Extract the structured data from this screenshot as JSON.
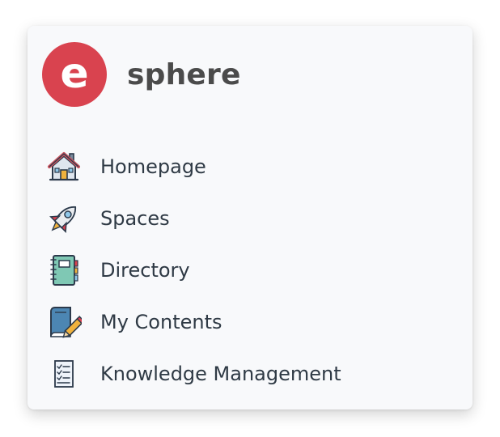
{
  "brand": {
    "logo_letter": "e",
    "name": "sphere",
    "logo_color": "#d9434f"
  },
  "menu": {
    "items": [
      {
        "label": "Homepage",
        "icon": "house-icon"
      },
      {
        "label": "Spaces",
        "icon": "rocket-icon"
      },
      {
        "label": "Directory",
        "icon": "notebook-icon"
      },
      {
        "label": "My Contents",
        "icon": "book-pencil-icon"
      },
      {
        "label": "Knowledge Management",
        "icon": "checklist-icon"
      }
    ]
  }
}
